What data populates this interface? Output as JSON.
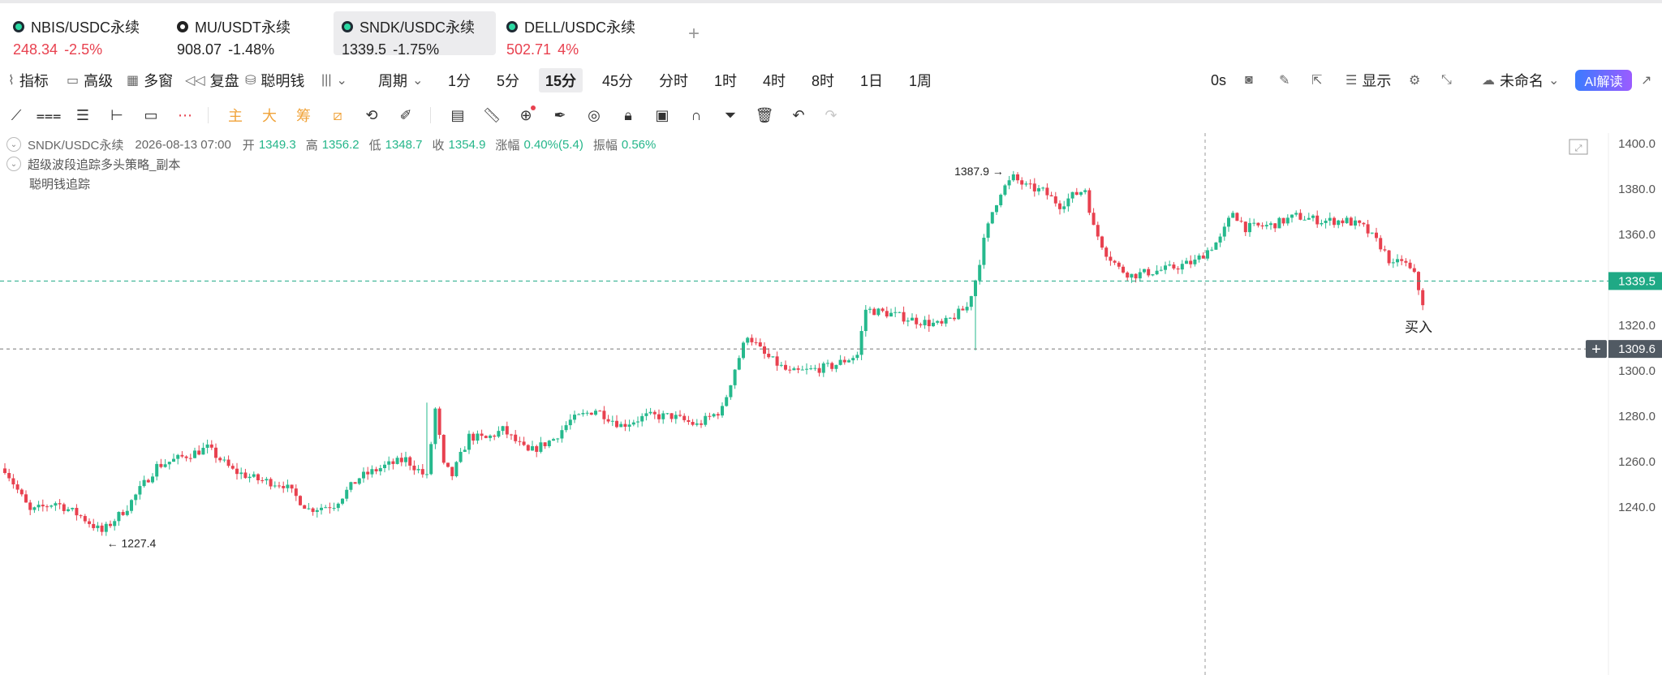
{
  "tabs": [
    {
      "symbol": "NBIS/USDC永续",
      "price": "248.34",
      "change": "-2.5%",
      "active": false
    },
    {
      "symbol": "MU/USDT永续",
      "price": "908.07",
      "change": "-1.48%",
      "active": false
    },
    {
      "symbol": "SNDK/USDC永续",
      "price": "1339.5",
      "change": "-1.75%",
      "active": true
    },
    {
      "symbol": "DELL/USDC永续",
      "price": "502.71",
      "change": "4%",
      "active": false
    }
  ],
  "add_tab": "+",
  "toolbar": {
    "indicators": "指标",
    "advanced": "高级",
    "multi_window": "多窗",
    "replay": "复盘",
    "smart_money": "聪明钱",
    "period": "周期",
    "intervals": [
      "1分",
      "5分",
      "15分",
      "45分",
      "分时",
      "1时",
      "4时",
      "8时",
      "1日",
      "1周"
    ],
    "active_interval": "15分",
    "countdown": "0s",
    "display": "显示",
    "unnamed": "未命名",
    "ai": "AI解读"
  },
  "drawing_tools": {
    "main": "主",
    "big": "大",
    "chip": "筹"
  },
  "legend": {
    "symbol": "SNDK/USDC永续",
    "datetime": "2026-08-13 07:00",
    "open_label": "开",
    "open": "1349.3",
    "high_label": "高",
    "high": "1356.2",
    "low_label": "低",
    "low": "1348.7",
    "close_label": "收",
    "close": "1354.9",
    "change_label": "涨幅",
    "change": "0.40%(5.4)",
    "amp_label": "振幅",
    "amp": "0.56%",
    "indicator1": "超级波段追踪多头策略_副本",
    "indicator2": "聪明钱追踪"
  },
  "colors": {
    "up": "#26b98d",
    "down": "#e8414f",
    "price_line": "#1fa985",
    "crosshair_tag": "#515a63"
  },
  "chart_data": {
    "type": "candlestick",
    "interval": "15分",
    "y_ticks": [
      1400.0,
      1380.0,
      1360.0,
      1340.0,
      1320.0,
      1300.0,
      1280.0,
      1260.0,
      1240.0
    ],
    "y_tick_labels": [
      "1400.0",
      "1380.0",
      "1360.0",
      "1320.0",
      "1300.0",
      "1280.0",
      "1260.0",
      "1240.0"
    ],
    "ylim": [
      1230,
      1405
    ],
    "last_price": "1339.5",
    "crosshair_price": "1309.6",
    "high_marker": "1387.9",
    "low_marker": "1227.4",
    "signal_label": "买入",
    "key_points": [
      [
        0,
        1257
      ],
      [
        6,
        1238
      ],
      [
        12,
        1242
      ],
      [
        18,
        1236
      ],
      [
        23,
        1229
      ],
      [
        29,
        1240
      ],
      [
        36,
        1258
      ],
      [
        42,
        1262
      ],
      [
        48,
        1266
      ],
      [
        54,
        1256
      ],
      [
        60,
        1252
      ],
      [
        66,
        1250
      ],
      [
        72,
        1239
      ],
      [
        78,
        1241
      ],
      [
        84,
        1253
      ],
      [
        90,
        1258
      ],
      [
        95,
        1261
      ],
      [
        100,
        1253
      ],
      [
        102,
        1283
      ],
      [
        104,
        1258
      ],
      [
        106,
        1254
      ],
      [
        110,
        1271
      ],
      [
        114,
        1270
      ],
      [
        118,
        1274
      ],
      [
        124,
        1264
      ],
      [
        130,
        1270
      ],
      [
        134,
        1278
      ],
      [
        140,
        1283
      ],
      [
        146,
        1276
      ],
      [
        152,
        1280
      ],
      [
        158,
        1280
      ],
      [
        164,
        1276
      ],
      [
        170,
        1283
      ],
      [
        173,
        1301
      ],
      [
        176,
        1316
      ],
      [
        180,
        1307
      ],
      [
        186,
        1299
      ],
      [
        190,
        1300
      ],
      [
        196,
        1302
      ],
      [
        202,
        1307
      ],
      [
        204,
        1327
      ],
      [
        210,
        1325
      ],
      [
        216,
        1322
      ],
      [
        222,
        1320
      ],
      [
        228,
        1328
      ],
      [
        230,
        1340
      ],
      [
        232,
        1357
      ],
      [
        234,
        1370
      ],
      [
        236,
        1379
      ],
      [
        239,
        1385
      ],
      [
        242,
        1381
      ],
      [
        246,
        1379
      ],
      [
        250,
        1373
      ],
      [
        253,
        1377
      ],
      [
        256,
        1380
      ],
      [
        258,
        1363
      ],
      [
        261,
        1352
      ],
      [
        264,
        1345
      ],
      [
        267,
        1342
      ],
      [
        270,
        1343
      ],
      [
        276,
        1345
      ],
      [
        282,
        1348
      ],
      [
        288,
        1358
      ],
      [
        291,
        1370
      ],
      [
        294,
        1363
      ],
      [
        300,
        1364
      ],
      [
        306,
        1368
      ],
      [
        312,
        1366
      ],
      [
        318,
        1366
      ],
      [
        322,
        1363
      ],
      [
        326,
        1355
      ],
      [
        329,
        1346
      ],
      [
        331,
        1349
      ],
      [
        334,
        1342
      ],
      [
        336,
        1330
      ]
    ]
  }
}
